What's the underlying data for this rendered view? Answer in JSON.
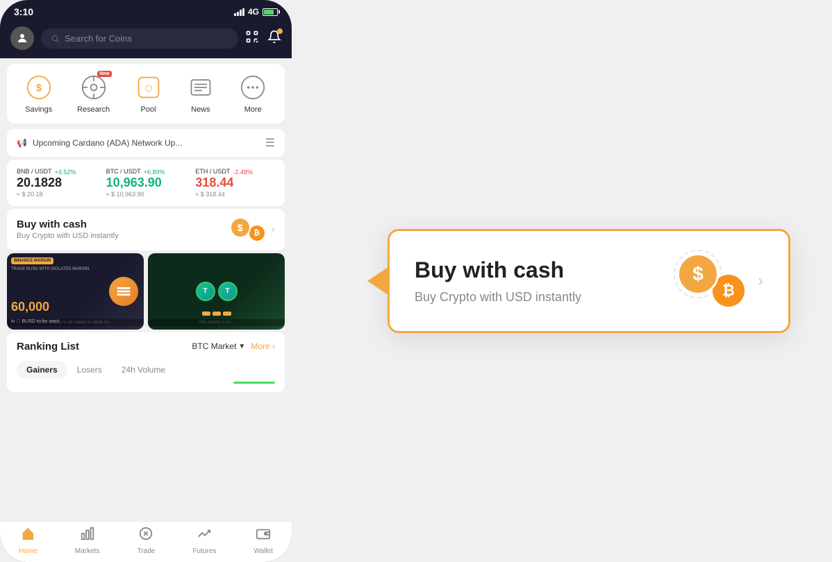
{
  "status_bar": {
    "time": "3:10",
    "network": "4G"
  },
  "top_bar": {
    "search_placeholder": "Search for Coins"
  },
  "quick_links": {
    "items": [
      {
        "id": "savings",
        "label": "Savings",
        "icon": "💰",
        "badge": null
      },
      {
        "id": "research",
        "label": "Research",
        "icon": "🔬",
        "badge": "New"
      },
      {
        "id": "pool",
        "label": "Pool",
        "icon": "🏊",
        "badge": null
      },
      {
        "id": "news",
        "label": "News",
        "icon": "📰",
        "badge": null
      },
      {
        "id": "more",
        "label": "More",
        "icon": "⋯",
        "badge": null
      }
    ]
  },
  "announcement": {
    "text": "Upcoming Cardano (ADA) Network Up..."
  },
  "prices": [
    {
      "pair": "BNB / USDT",
      "change": "+4.52%",
      "positive": true,
      "value": "20.1828",
      "usd": "≈ $ 20.18"
    },
    {
      "pair": "BTC / USDT",
      "change": "+6.89%",
      "positive": true,
      "value": "10,963.90",
      "usd": "≈ $ 10,963.90"
    },
    {
      "pair": "ETH / USDT",
      "change": "-2.48%",
      "positive": false,
      "value": "318.44",
      "usd": "≈ $ 318.44"
    }
  ],
  "buy_cash": {
    "title": "Buy with cash",
    "subtitle": "Buy Crypto with USD instantly"
  },
  "promo": {
    "left": {
      "label": "BINANCE MARGIN",
      "subtext": "TRADE BUSD WITH ISOLATED MARGIN",
      "amount": "60,000",
      "bottom": "in BUSD to be won!",
      "disclaimer": "This activity is not related to Apple Inc."
    },
    "right": {
      "disclaimer": "This activity is no..."
    }
  },
  "ranking": {
    "title": "Ranking List",
    "market": "BTC Market",
    "more": "More",
    "tabs": [
      {
        "id": "gainers",
        "label": "Gainers",
        "active": true
      },
      {
        "id": "losers",
        "label": "Losers",
        "active": false
      },
      {
        "id": "volume",
        "label": "24h Volume",
        "active": false
      }
    ]
  },
  "bottom_nav": {
    "items": [
      {
        "id": "home",
        "label": "Home",
        "icon": "🏠",
        "active": true
      },
      {
        "id": "markets",
        "label": "Markets",
        "icon": "📊",
        "active": false
      },
      {
        "id": "trade",
        "label": "Trade",
        "icon": "🔄",
        "active": false
      },
      {
        "id": "futures",
        "label": "Futures",
        "icon": "📈",
        "active": false
      },
      {
        "id": "wallet",
        "label": "Wallet",
        "icon": "👛",
        "active": false
      }
    ]
  },
  "popup": {
    "title": "Buy with cash",
    "subtitle": "Buy Crypto with USD instantly"
  }
}
